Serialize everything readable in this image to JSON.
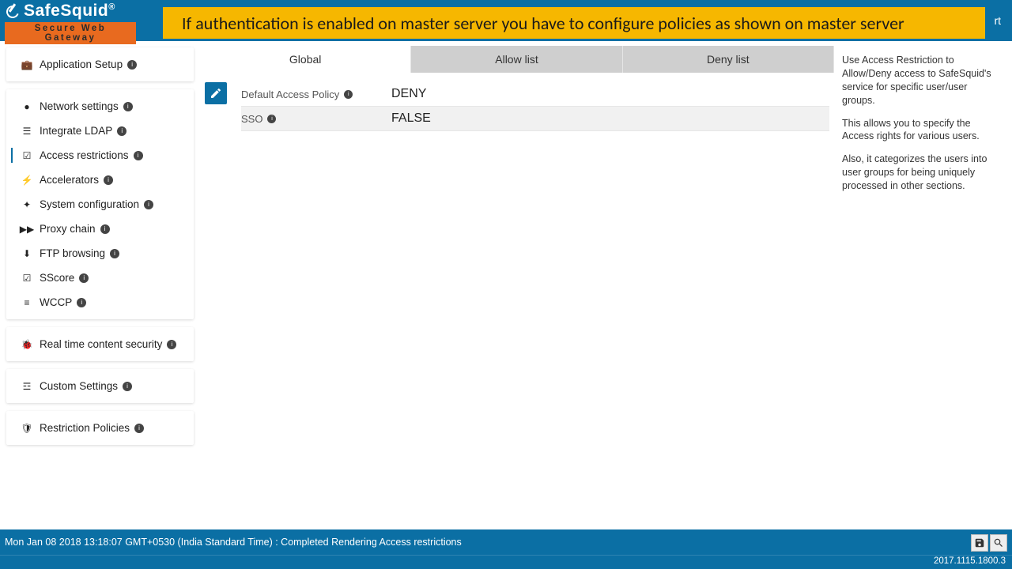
{
  "brand": {
    "name": "SafeSquid",
    "reg": "®",
    "tagline": "Secure Web Gateway"
  },
  "banner": "If authentication is enabled on master server you have to configure policies as shown on master server",
  "topnav": {
    "support": "rt"
  },
  "sidebar": {
    "groups": [
      {
        "items": [
          {
            "icon": "briefcase",
            "label": "Application Setup"
          }
        ]
      },
      {
        "items": [
          {
            "icon": "globe",
            "label": "Network settings"
          },
          {
            "icon": "list",
            "label": "Integrate LDAP"
          },
          {
            "icon": "check-square",
            "label": "Access restrictions",
            "active": true
          },
          {
            "icon": "bolt",
            "label": "Accelerators"
          },
          {
            "icon": "puzzle",
            "label": "System configuration"
          },
          {
            "icon": "forward",
            "label": "Proxy chain"
          },
          {
            "icon": "download",
            "label": "FTP browsing"
          },
          {
            "icon": "check-square",
            "label": "SScore"
          },
          {
            "icon": "bars",
            "label": "WCCP"
          }
        ]
      },
      {
        "items": [
          {
            "icon": "bug",
            "label": "Real time content security"
          }
        ]
      },
      {
        "items": [
          {
            "icon": "sliders",
            "label": "Custom Settings"
          }
        ]
      },
      {
        "items": [
          {
            "icon": "shield",
            "label": "Restriction Policies"
          }
        ]
      }
    ]
  },
  "tabs": {
    "global": "Global",
    "allow": "Allow list",
    "deny": "Deny list"
  },
  "global": {
    "rows": [
      {
        "key": "Default Access Policy",
        "val": "DENY"
      },
      {
        "key": "SSO",
        "val": "FALSE"
      }
    ]
  },
  "help": {
    "p1": "Use Access Restriction to Allow/Deny access to SafeSquid's service for specific user/user groups.",
    "p2": "This allows you to specify the Access rights for various users.",
    "p3": "Also, it categorizes the users into user groups for being uniquely processed in other sections."
  },
  "status": "Mon Jan 08 2018 13:18:07 GMT+0530 (India Standard Time) : Completed Rendering Access restrictions",
  "version": "2017.1115.1800.3"
}
